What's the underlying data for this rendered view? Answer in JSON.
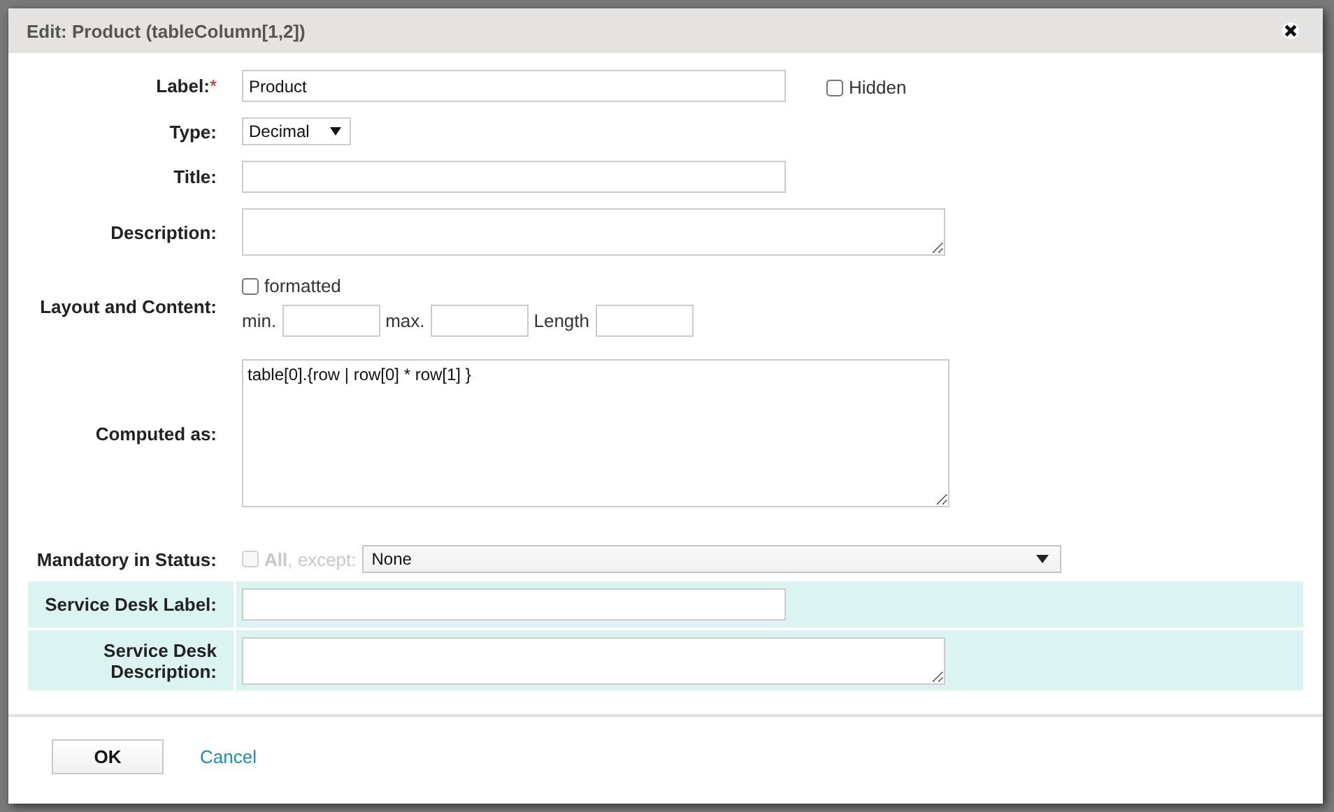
{
  "dialog": {
    "title": "Edit: Product (tableColumn[1,2])"
  },
  "label_field": {
    "label": "Label:",
    "required_mark": "*",
    "value": "Product",
    "hidden": {
      "label": "Hidden",
      "checked": false
    }
  },
  "type_field": {
    "label": "Type:",
    "value": "Decimal"
  },
  "title_field": {
    "label": "Title:"
  },
  "description_field": {
    "label": "Description:"
  },
  "layout_content": {
    "label": "Layout and Content:",
    "formatted": {
      "label": "formatted",
      "checked": false
    },
    "min": {
      "label": "min."
    },
    "max": {
      "label": "max."
    },
    "length": {
      "label": "Length"
    }
  },
  "computed_as": {
    "label": "Computed as:",
    "value": "table[0].{row | row[0] * row[1] }"
  },
  "mandatory": {
    "label": "Mandatory in Status:",
    "all": {
      "label": "**All**, except:",
      "checked": false,
      "disabled": true
    },
    "value": "None"
  },
  "service_desk": [
    {
      "kind": "input",
      "label": "Service Desk Label:"
    },
    {
      "kind": "textarea",
      "label": "Service Desk Description:"
    }
  ],
  "buttons": {
    "ok": "OK",
    "cancel": "Cancel"
  }
}
